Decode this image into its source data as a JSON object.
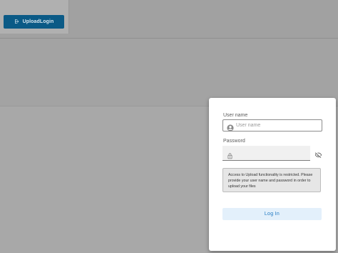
{
  "toolbar": {
    "upload_button_label": "UploadLogin",
    "upload_button_icon": "login-icon"
  },
  "login_dialog": {
    "username_label": "User name",
    "username_placeholder": "User name",
    "username_value": "",
    "username_icon": "account-circle-icon",
    "password_label": "Password",
    "password_value": "",
    "password_icon": "lock-icon",
    "visibility_icon": "eye-off-icon",
    "notice_text": "Access to Upload functionality is restricted. Please provide your user name and password in order to upload your files",
    "login_button_label": "Log In"
  },
  "colors": {
    "upload_button_bg": "#0b5a86",
    "login_button_bg": "#e3f0fb",
    "login_button_text": "#1f78c1",
    "backdrop": "#a9a9a9"
  }
}
